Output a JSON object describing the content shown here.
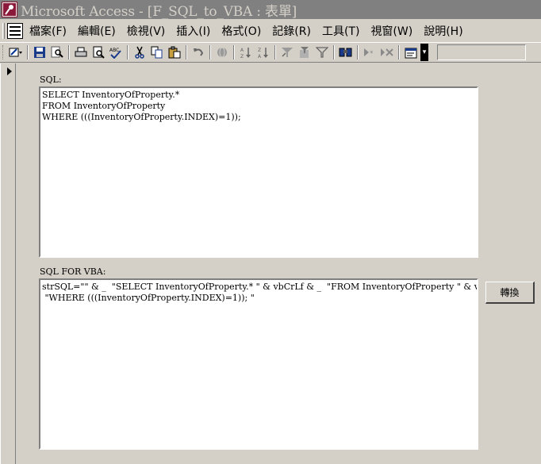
{
  "window": {
    "title": "Microsoft Access - [F_SQL_to_VBA : 表單]"
  },
  "menu": {
    "items": [
      {
        "label": "檔案(F)"
      },
      {
        "label": "編輯(E)"
      },
      {
        "label": "檢視(V)"
      },
      {
        "label": "插入(I)"
      },
      {
        "label": "格式(O)"
      },
      {
        "label": "記錄(R)"
      },
      {
        "label": "工具(T)"
      },
      {
        "label": "視窗(W)"
      },
      {
        "label": "說明(H)"
      }
    ]
  },
  "toolbar": {
    "icons": [
      "view-icon",
      "save-icon",
      "search-icon",
      "print-icon",
      "print-preview-icon",
      "spelling-icon",
      "cut-icon",
      "copy-icon",
      "paste-icon",
      "undo-icon",
      "hyperlink-icon",
      "sort-ascending-icon",
      "sort-descending-icon",
      "filter-by-selection-icon",
      "filter-by-form-icon",
      "apply-filter-icon",
      "find-icon",
      "new-record-icon",
      "delete-record-icon",
      "properties-icon"
    ]
  },
  "form": {
    "sql_label": "SQL:",
    "sql_value": "SELECT InventoryOfProperty.*\nFROM InventoryOfProperty\nWHERE (((InventoryOfProperty.INDEX)=1));",
    "vba_label": "SQL FOR VBA:",
    "vba_value": "strSQL=\"\" & _  \"SELECT InventoryOfProperty.* \" & vbCrLf & _  \"FROM InventoryOfProperty \" & vbCrLf & _\n \"WHERE (((InventoryOfProperty.INDEX)=1)); \"",
    "convert_button_label": "轉換"
  },
  "colors": {
    "titlebar_inactive": "#808080",
    "face": "#d4d0c8"
  }
}
